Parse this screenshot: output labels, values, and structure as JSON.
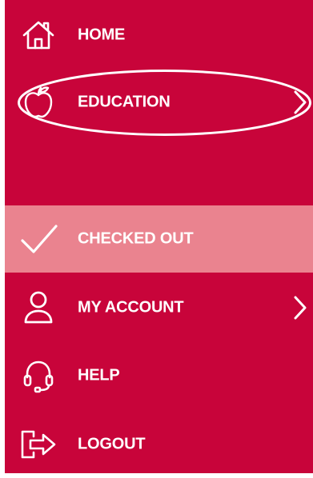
{
  "menu": {
    "items": [
      {
        "label": "HOME",
        "icon": "home-icon"
      },
      {
        "label": "EDUCATION",
        "icon": "apple-icon",
        "has_submenu": true
      },
      {
        "label": "CHECKED OUT",
        "icon": "checkmark-icon",
        "selected": true
      },
      {
        "label": "MY ACCOUNT",
        "icon": "user-icon",
        "has_submenu": true
      },
      {
        "label": "HELP",
        "icon": "headset-icon"
      },
      {
        "label": "LOGOUT",
        "icon": "logout-icon"
      }
    ]
  },
  "colors": {
    "background": "#c8043a",
    "selected_background": "#ea838f",
    "text": "#ffffff"
  }
}
